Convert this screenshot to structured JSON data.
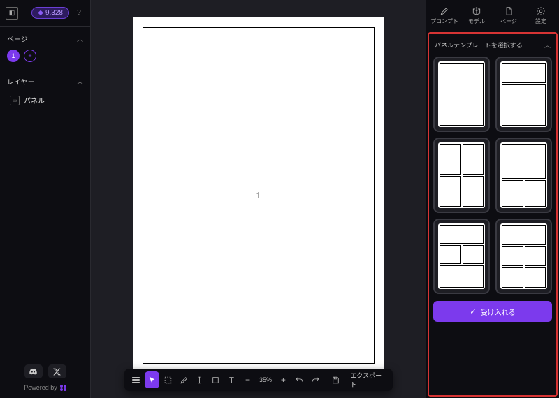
{
  "gems": "9,328",
  "sections": {
    "pages": "ページ",
    "layers": "レイヤー"
  },
  "page_number": "1",
  "add_page": "+",
  "layer_panel": "パネル",
  "powered": "Powered by",
  "zoom": "35%",
  "export": "エクスポート",
  "tabs": {
    "prompt": "プロンプト",
    "model": "モデル",
    "page": "ページ",
    "settings": "設定"
  },
  "template_header": "パネルテンプレートを選択する",
  "accept": "受け入れる",
  "canvas_page": "1"
}
